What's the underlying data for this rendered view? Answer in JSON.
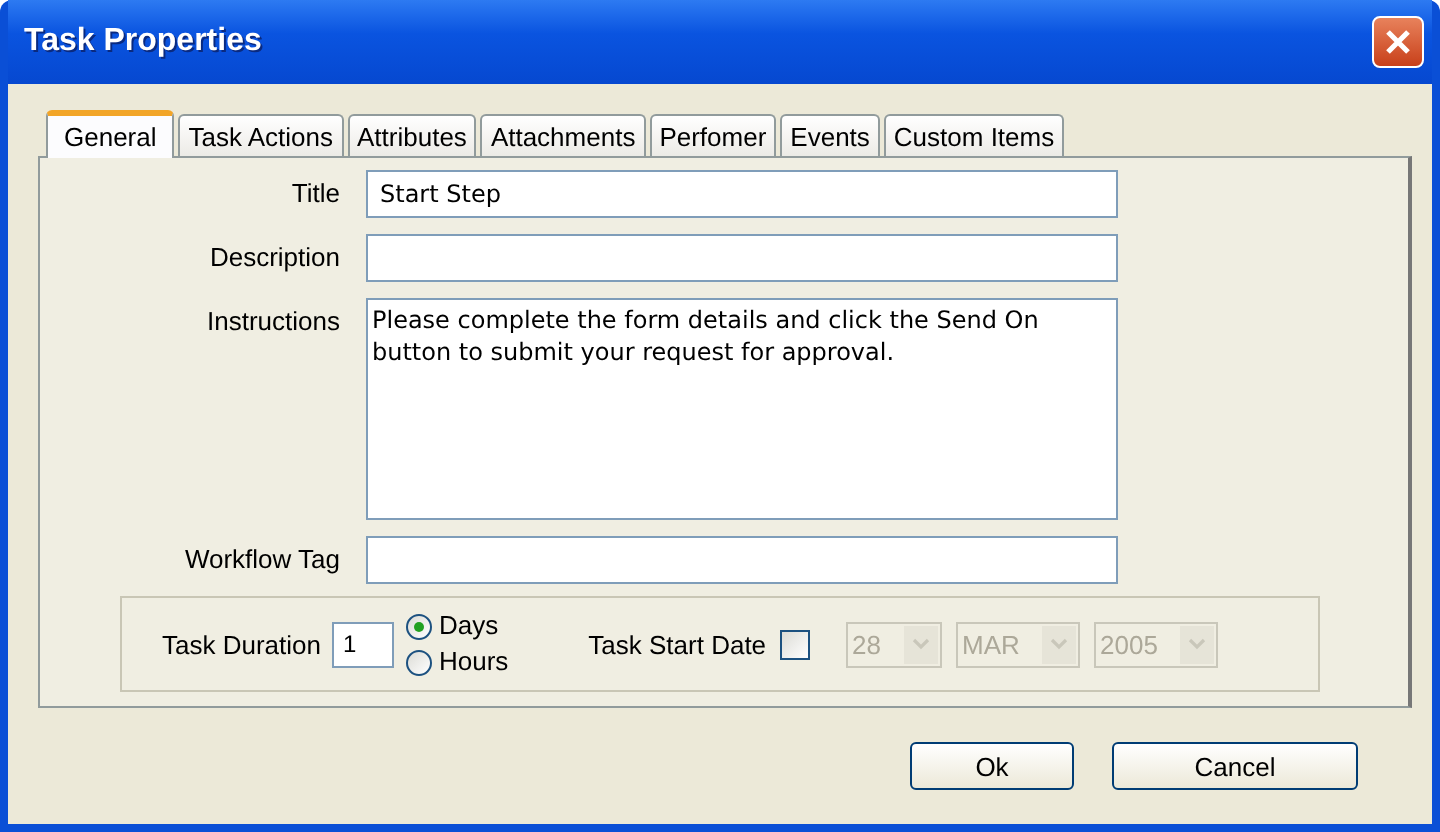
{
  "window": {
    "title": "Task Properties"
  },
  "tabs": [
    {
      "label": "General",
      "selected": true
    },
    {
      "label": "Task Actions",
      "selected": false
    },
    {
      "label": "Attributes",
      "selected": false
    },
    {
      "label": "Attachments",
      "selected": false
    },
    {
      "label": "Perfomer",
      "selected": false
    },
    {
      "label": "Events",
      "selected": false
    },
    {
      "label": "Custom Items",
      "selected": false
    }
  ],
  "fields": [
    {
      "label": "Title",
      "kind": "text",
      "value": "Start Step"
    },
    {
      "label": "Description",
      "kind": "text"
    },
    {
      "label": "Instructions",
      "kind": "multiline",
      "value": "Please complete the form details and click the Send On button to submit your request for approval."
    },
    {
      "label": "Workflow Tag",
      "kind": "text"
    }
  ],
  "duration": {
    "label": "Task Duration",
    "value": "1",
    "units": [
      {
        "label": "Days",
        "selected": true
      },
      {
        "label": "Hours",
        "selected": false
      }
    ]
  },
  "start_date": {
    "label": "Task Start Date",
    "checked": false,
    "disabled": true,
    "selects": [
      "28",
      "MAR",
      "2005"
    ]
  },
  "buttons": [
    "Ok",
    "Cancel"
  ]
}
